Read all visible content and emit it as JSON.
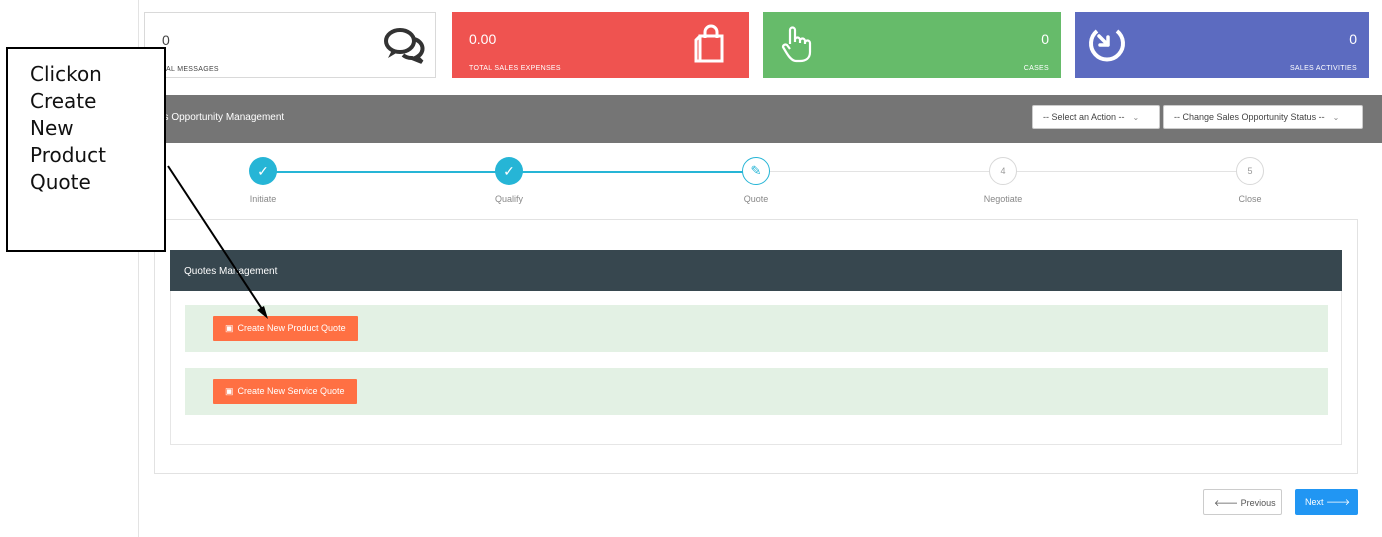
{
  "cards": [
    {
      "value": "0",
      "caption": "TAL MESSAGES",
      "icon": "speech-bubbles-icon",
      "color": "#ffffff"
    },
    {
      "value": "0.00",
      "caption": "TOTAL SALES EXPENSES",
      "icon": "shopping-bag-icon",
      "color": "#ef5350"
    },
    {
      "value": "0",
      "caption": "CASES",
      "icon": "pointing-hand-icon",
      "color": "#66bb6a"
    },
    {
      "value": "0",
      "caption": "SALES ACTIVITIES",
      "icon": "circle-arrow-icon",
      "color": "#5c6bc0"
    }
  ],
  "management_bar": {
    "title": "es Opportunity Management",
    "action_select": "-- Select an Action --",
    "status_select": "-- Change Sales Opportunity Status --"
  },
  "wizard": {
    "steps": [
      {
        "label": "Initiate",
        "state": "done",
        "marker": "✓"
      },
      {
        "label": "Qualify",
        "state": "done",
        "marker": "✓"
      },
      {
        "label": "Quote",
        "state": "current",
        "marker": "✎"
      },
      {
        "label": "Negotiate",
        "state": "todo",
        "marker": "4"
      },
      {
        "label": "Close",
        "state": "todo",
        "marker": "5"
      }
    ]
  },
  "quotes": {
    "title": "Quotes Management",
    "product_button": "Create New Product Quote",
    "service_button": "Create New Service Quote"
  },
  "footer": {
    "previous": "Previous",
    "next": "Next"
  },
  "annotation": {
    "text": "Clickon Create New Product Quote"
  },
  "colors": {
    "accent": "#26b5d6",
    "button": "#ff7043",
    "next": "#2196f3",
    "header": "#37474f"
  }
}
